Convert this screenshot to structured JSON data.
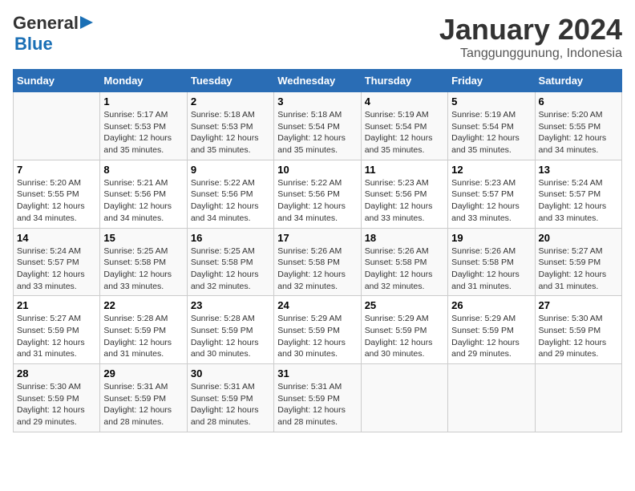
{
  "header": {
    "logo_line1": "General",
    "logo_line2": "Blue",
    "month_year": "January 2024",
    "location": "Tanggunggunung, Indonesia"
  },
  "days_of_week": [
    "Sunday",
    "Monday",
    "Tuesday",
    "Wednesday",
    "Thursday",
    "Friday",
    "Saturday"
  ],
  "weeks": [
    [
      {
        "day": "",
        "detail": ""
      },
      {
        "day": "1",
        "detail": "Sunrise: 5:17 AM\nSunset: 5:53 PM\nDaylight: 12 hours\nand 35 minutes."
      },
      {
        "day": "2",
        "detail": "Sunrise: 5:18 AM\nSunset: 5:53 PM\nDaylight: 12 hours\nand 35 minutes."
      },
      {
        "day": "3",
        "detail": "Sunrise: 5:18 AM\nSunset: 5:54 PM\nDaylight: 12 hours\nand 35 minutes."
      },
      {
        "day": "4",
        "detail": "Sunrise: 5:19 AM\nSunset: 5:54 PM\nDaylight: 12 hours\nand 35 minutes."
      },
      {
        "day": "5",
        "detail": "Sunrise: 5:19 AM\nSunset: 5:54 PM\nDaylight: 12 hours\nand 35 minutes."
      },
      {
        "day": "6",
        "detail": "Sunrise: 5:20 AM\nSunset: 5:55 PM\nDaylight: 12 hours\nand 34 minutes."
      }
    ],
    [
      {
        "day": "7",
        "detail": "Sunrise: 5:20 AM\nSunset: 5:55 PM\nDaylight: 12 hours\nand 34 minutes."
      },
      {
        "day": "8",
        "detail": "Sunrise: 5:21 AM\nSunset: 5:56 PM\nDaylight: 12 hours\nand 34 minutes."
      },
      {
        "day": "9",
        "detail": "Sunrise: 5:22 AM\nSunset: 5:56 PM\nDaylight: 12 hours\nand 34 minutes."
      },
      {
        "day": "10",
        "detail": "Sunrise: 5:22 AM\nSunset: 5:56 PM\nDaylight: 12 hours\nand 34 minutes."
      },
      {
        "day": "11",
        "detail": "Sunrise: 5:23 AM\nSunset: 5:56 PM\nDaylight: 12 hours\nand 33 minutes."
      },
      {
        "day": "12",
        "detail": "Sunrise: 5:23 AM\nSunset: 5:57 PM\nDaylight: 12 hours\nand 33 minutes."
      },
      {
        "day": "13",
        "detail": "Sunrise: 5:24 AM\nSunset: 5:57 PM\nDaylight: 12 hours\nand 33 minutes."
      }
    ],
    [
      {
        "day": "14",
        "detail": "Sunrise: 5:24 AM\nSunset: 5:57 PM\nDaylight: 12 hours\nand 33 minutes."
      },
      {
        "day": "15",
        "detail": "Sunrise: 5:25 AM\nSunset: 5:58 PM\nDaylight: 12 hours\nand 33 minutes."
      },
      {
        "day": "16",
        "detail": "Sunrise: 5:25 AM\nSunset: 5:58 PM\nDaylight: 12 hours\nand 32 minutes."
      },
      {
        "day": "17",
        "detail": "Sunrise: 5:26 AM\nSunset: 5:58 PM\nDaylight: 12 hours\nand 32 minutes."
      },
      {
        "day": "18",
        "detail": "Sunrise: 5:26 AM\nSunset: 5:58 PM\nDaylight: 12 hours\nand 32 minutes."
      },
      {
        "day": "19",
        "detail": "Sunrise: 5:26 AM\nSunset: 5:58 PM\nDaylight: 12 hours\nand 31 minutes."
      },
      {
        "day": "20",
        "detail": "Sunrise: 5:27 AM\nSunset: 5:59 PM\nDaylight: 12 hours\nand 31 minutes."
      }
    ],
    [
      {
        "day": "21",
        "detail": "Sunrise: 5:27 AM\nSunset: 5:59 PM\nDaylight: 12 hours\nand 31 minutes."
      },
      {
        "day": "22",
        "detail": "Sunrise: 5:28 AM\nSunset: 5:59 PM\nDaylight: 12 hours\nand 31 minutes."
      },
      {
        "day": "23",
        "detail": "Sunrise: 5:28 AM\nSunset: 5:59 PM\nDaylight: 12 hours\nand 30 minutes."
      },
      {
        "day": "24",
        "detail": "Sunrise: 5:29 AM\nSunset: 5:59 PM\nDaylight: 12 hours\nand 30 minutes."
      },
      {
        "day": "25",
        "detail": "Sunrise: 5:29 AM\nSunset: 5:59 PM\nDaylight: 12 hours\nand 30 minutes."
      },
      {
        "day": "26",
        "detail": "Sunrise: 5:29 AM\nSunset: 5:59 PM\nDaylight: 12 hours\nand 29 minutes."
      },
      {
        "day": "27",
        "detail": "Sunrise: 5:30 AM\nSunset: 5:59 PM\nDaylight: 12 hours\nand 29 minutes."
      }
    ],
    [
      {
        "day": "28",
        "detail": "Sunrise: 5:30 AM\nSunset: 5:59 PM\nDaylight: 12 hours\nand 29 minutes."
      },
      {
        "day": "29",
        "detail": "Sunrise: 5:31 AM\nSunset: 5:59 PM\nDaylight: 12 hours\nand 28 minutes."
      },
      {
        "day": "30",
        "detail": "Sunrise: 5:31 AM\nSunset: 5:59 PM\nDaylight: 12 hours\nand 28 minutes."
      },
      {
        "day": "31",
        "detail": "Sunrise: 5:31 AM\nSunset: 5:59 PM\nDaylight: 12 hours\nand 28 minutes."
      },
      {
        "day": "",
        "detail": ""
      },
      {
        "day": "",
        "detail": ""
      },
      {
        "day": "",
        "detail": ""
      }
    ]
  ]
}
